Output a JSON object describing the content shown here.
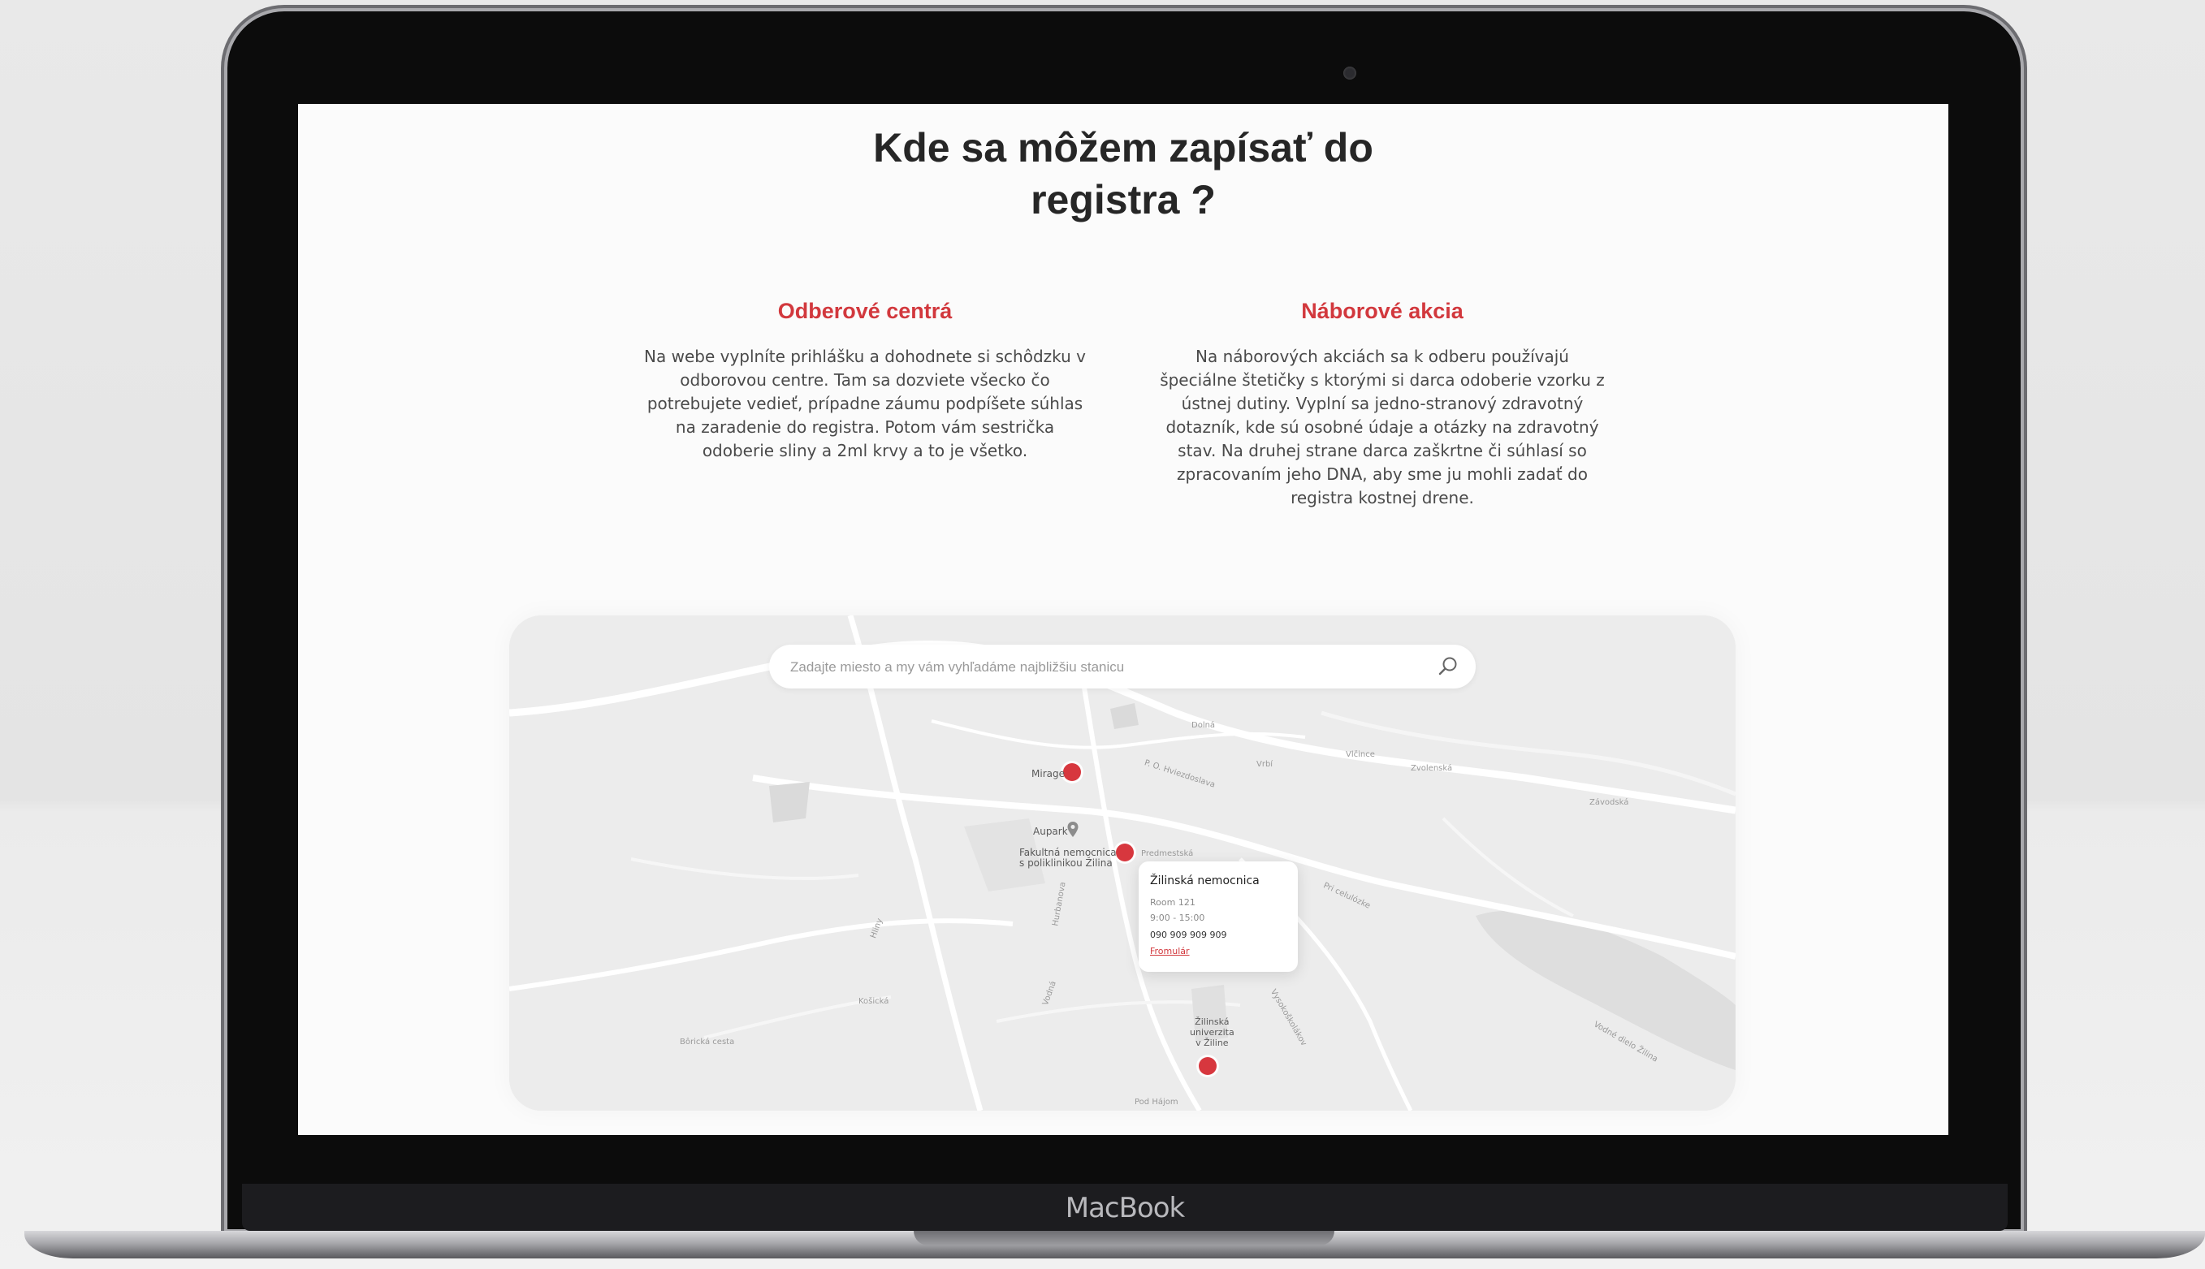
{
  "device": {
    "brand": "MacBook"
  },
  "page": {
    "title_line1": "Kde sa môžem zapísať do",
    "title_line2": "registra ?"
  },
  "sections": [
    {
      "heading": "Odberové centrá",
      "text": "Na webe vyplníte prihlášku a dohodnete si schôdzku v odborovou centre. Tam sa dozviete všecko čo potrebujete vedieť, prípadne záumu podpíšete súhlas na zaradenie do registra. Potom vám sestrička odoberie sliny a 2ml krvy a to je všetko."
    },
    {
      "heading": "Náborové akcia",
      "text": "Na náborových akciách sa k odberu používajú špeciálne štetičky s ktorými si darca odoberie vzorku z ústnej dutiny. Vyplní sa jedno-stranový zdravotný dotazník, kde sú osobné údaje a otázky na zdravotný stav. Na druhej strane darca zaškrtne či súhlasí so zpracovaním jeho DNA, aby sme ju mohli zadať do registra kostnej drene."
    }
  ],
  "map": {
    "search": {
      "placeholder": "Zadajte miesto a my vám vyhľadáme najbližšiu stanicu",
      "icon": "search-icon"
    },
    "places": {
      "mirage": "Mirage",
      "aupark": "Aupark",
      "hospital_line1": "Fakultná nemocnica",
      "hospital_line2": "s poliklinikou Žilina",
      "uni_line1": "Žilinská",
      "uni_line2": "univerzita",
      "uni_line3": "v Žiline"
    },
    "streets": [
      "Dolná",
      "Vrbí",
      "P. O. Hviezdoslava",
      "Predmestská",
      "Zvolenská",
      "Závodská",
      "Vlčince",
      "Vodná",
      "Pri celulózke",
      "Vodné dielo Žilina",
      "Hurbanova",
      "Košická",
      "Hliny",
      "Bôrická cesta",
      "Vysokoškolákov",
      "Pod Hájom"
    ],
    "popup": {
      "title": "Žilinská nemocnica",
      "room": "Room 121",
      "hours": "9:00 - 15:00",
      "phone": "090 909 909 909",
      "link": "Fromulár"
    },
    "marker_color": "#d7373e"
  },
  "colors": {
    "accent": "#d2383d",
    "title": "#262626",
    "body_text": "#4a4a4a"
  }
}
